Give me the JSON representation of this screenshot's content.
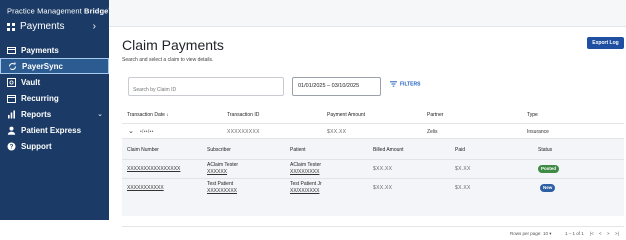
{
  "brand": {
    "text_regular": "Practice Management",
    "text_bold": "Bridge",
    "mark": "®"
  },
  "sidebar": {
    "section_label": "Payments",
    "section_chevron": "›",
    "items": [
      {
        "label": "Payments",
        "icon": "payment-card-icon"
      },
      {
        "label": "PayerSync",
        "icon": "sync-icon",
        "active": true
      },
      {
        "label": "Vault",
        "icon": "vault-icon"
      },
      {
        "label": "Recurring",
        "icon": "calendar-icon"
      },
      {
        "label": "Reports",
        "icon": "reports-icon",
        "chevron": "⌄"
      },
      {
        "label": "Patient Express",
        "icon": "person-icon"
      },
      {
        "label": "Support",
        "icon": "help-icon"
      }
    ]
  },
  "main": {
    "title": "Claim Payments",
    "subtitle": "Search and select a claim to view details.",
    "export_label": "Export Log",
    "search_placeholder": "Search by Claim ID",
    "date_range": "01/01/2025 – 03/10/2025",
    "filters_label": "FILTERS"
  },
  "table": {
    "columns": [
      "Transaction Date",
      "Transaction ID",
      "Payment Amount",
      "Partner",
      "Type"
    ],
    "sort_indicator": "↓",
    "row": {
      "expand": "⌄",
      "date": "•/••/••",
      "transaction_id": "XXXXXXXXX",
      "amount": "$XX.XX",
      "partner": "Zelis",
      "type": "Insurance"
    }
  },
  "subtable": {
    "columns": [
      "Claim Number",
      "Subscriber",
      "Patient",
      "Billed Amount",
      "Paid",
      "Status"
    ],
    "rows": [
      {
        "claim": "XXXXXXXXXXXXXXXX",
        "subscriber_name": "AClaim Tester",
        "subscriber_id": "XXXXXX",
        "patient_name": "AClaim Tester",
        "patient_dob": "XX/XX/XXXX",
        "billed": "$XX.XX",
        "paid": "$X.XX",
        "status": "Posted"
      },
      {
        "claim": "XXXXXXXXXXX",
        "subscriber_name": "Test Patient",
        "subscriber_id": "XXXXXXXXX",
        "patient_name": "Test Patient Jr",
        "patient_dob": "XX/XX/XXXX",
        "billed": "$XX.XX",
        "paid": "$X.XX",
        "status": "New"
      }
    ]
  },
  "footer": {
    "rows_label": "Rows per page:",
    "rows_value": "10",
    "range": "1 – 1 of 1",
    "nav_first": "|<",
    "nav_prev": "<",
    "nav_next": ">",
    "nav_last": ">|"
  },
  "colors": {
    "sidebar_bg": "#1b3b66",
    "active_bg": "#2b5b91",
    "accent": "#1e4fa0",
    "posted": "#3f8b46",
    "new": "#2e5fa5"
  }
}
